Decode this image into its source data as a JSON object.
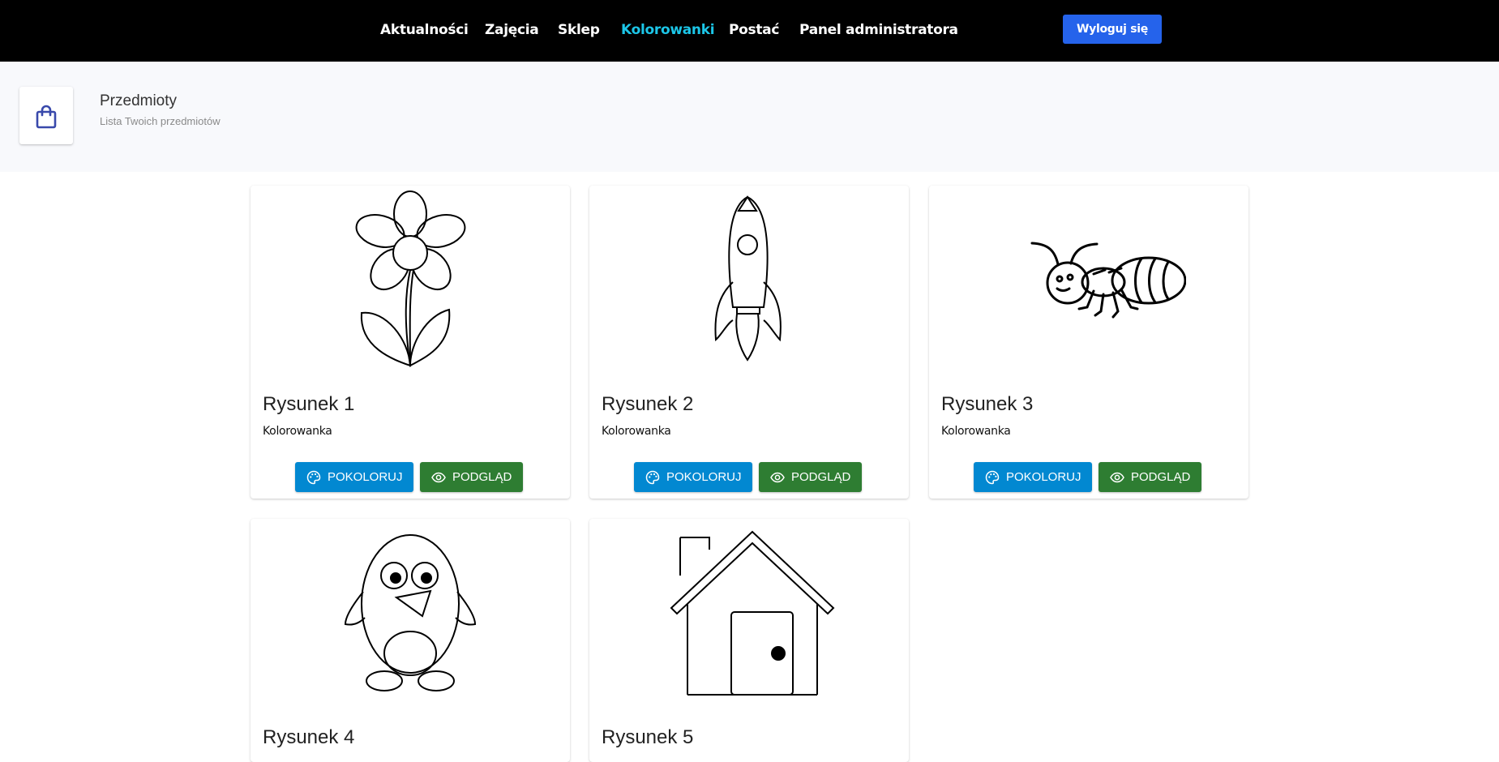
{
  "nav": {
    "links": [
      {
        "label": "Aktualności",
        "active": false
      },
      {
        "label": "Zajęcia",
        "active": false
      },
      {
        "label": "Sklep",
        "active": false
      },
      {
        "label": "Kolorowanki",
        "active": true
      },
      {
        "label": "Postać",
        "active": false
      },
      {
        "label": "Panel administratora",
        "active": false
      }
    ],
    "logout_label": "Wyloguj się"
  },
  "header": {
    "icon": "shopping-bag-icon",
    "title": "Przedmioty",
    "subtitle": "Lista Twoich przedmiotów"
  },
  "cards": [
    {
      "title": "Rysunek 1",
      "subtitle": "Kolorowanka",
      "image": "flower-drawing",
      "color_label": "POKOLORUJ",
      "preview_label": "PODGLĄD"
    },
    {
      "title": "Rysunek 2",
      "subtitle": "Kolorowanka",
      "image": "rocket-drawing",
      "color_label": "POKOLORUJ",
      "preview_label": "PODGLĄD"
    },
    {
      "title": "Rysunek 3",
      "subtitle": "Kolorowanka",
      "image": "ant-drawing",
      "color_label": "POKOLORUJ",
      "preview_label": "PODGLĄD"
    },
    {
      "title": "Rysunek 4",
      "image": "penguin-drawing"
    },
    {
      "title": "Rysunek 5",
      "image": "house-drawing"
    }
  ],
  "colors": {
    "navbar_bg": "#000000",
    "nav_active": "#1cc6e8",
    "logout_bg": "#2563eb",
    "color_button": "#0288d1",
    "preview_button": "#2e7d32",
    "header_icon": "#3949ab"
  }
}
